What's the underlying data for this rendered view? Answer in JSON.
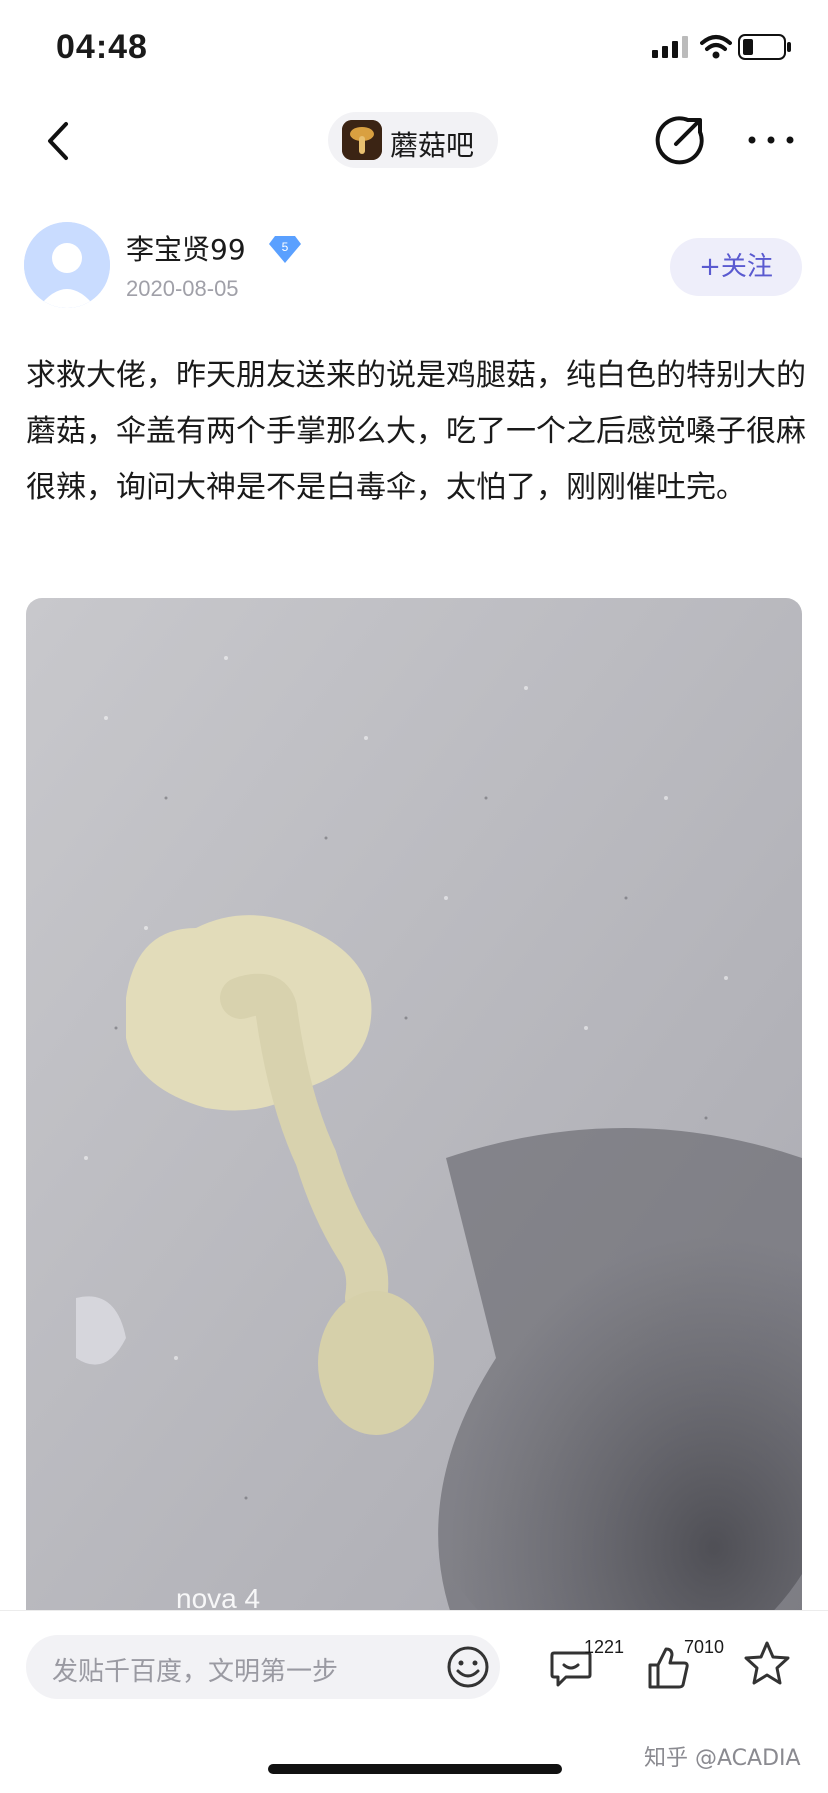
{
  "status_bar": {
    "time": "04:48"
  },
  "nav": {
    "forum_name": "蘑菇吧",
    "icons": [
      "back-arrow-icon",
      "edit-icon",
      "more-icon"
    ]
  },
  "post": {
    "author": "李宝贤99",
    "level": "5",
    "date": "2020-08-05",
    "follow_label": "+关注",
    "text": "求救大佬，昨天朋友送来的说是鸡腿菇，纯白色的特别大的蘑菇，伞盖有两个手掌那么大，吃了一个之后感觉嗓子很麻很辣，询问大神是不是白毒伞，太怕了，刚刚催吐完。",
    "image_watermark": "nova 4"
  },
  "bottom_bar": {
    "reply_placeholder": "发贴千百度，文明第一步",
    "comment_count": "1221",
    "like_count": "7010",
    "icons": [
      "emoji-icon",
      "comment-icon",
      "like-icon",
      "star-icon"
    ]
  },
  "watermark": "知乎 @ACADIA",
  "colors": {
    "accent": "#5a5ad0",
    "follow_bg": "#eeeefa",
    "level_badge": "#5aa0ff"
  }
}
